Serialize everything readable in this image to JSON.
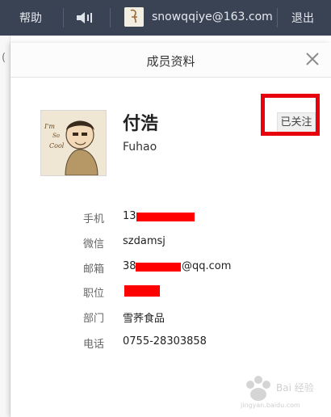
{
  "topbar": {
    "help": "帮助",
    "email": "snowqqiye@163.com",
    "logout": "退出"
  },
  "background": {
    "paren": "("
  },
  "dialog": {
    "title": "成员资料",
    "follow_label": "已关注"
  },
  "profile": {
    "name": "付浩",
    "pinyin": "Fuhao",
    "avatar_text": [
      "I'm",
      "So",
      "Cool"
    ],
    "fields": [
      {
        "label": "手机",
        "value": "13"
      },
      {
        "label": "微信",
        "value": "szdamsj"
      },
      {
        "label": "邮箱",
        "value_prefix": "38",
        "value_suffix": "@qq.com"
      },
      {
        "label": "职位",
        "value": ""
      },
      {
        "label": "部门",
        "value": "雪荞食品"
      },
      {
        "label": "电话",
        "value": "0755-28303858"
      }
    ]
  },
  "icons": {
    "volume": "volume-icon",
    "close": "close-icon"
  },
  "colors": {
    "topbar_bg": "#3a4354",
    "redaction": "#ff0000",
    "highlight": "#e8000c"
  },
  "watermark": {
    "text": "Bai 经验",
    "subtext": "jingyan.baidu.com"
  }
}
